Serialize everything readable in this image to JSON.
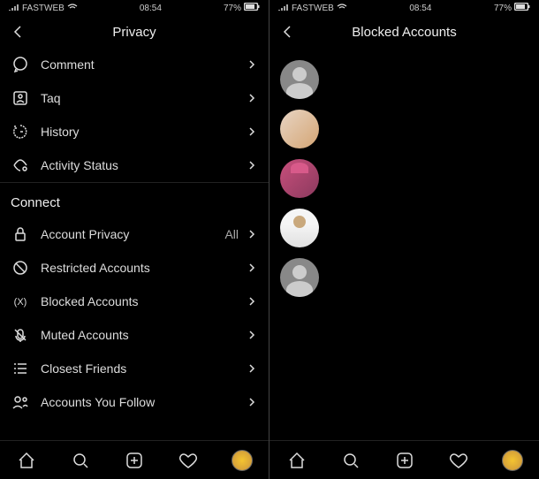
{
  "left": {
    "status": {
      "carrier": "FASTWEB",
      "time": "08:54",
      "battery": "77%"
    },
    "header": {
      "title": "Privacy"
    },
    "menu1": [
      {
        "icon": "comment-icon",
        "label": "Comment"
      },
      {
        "icon": "tag-icon",
        "label": "Taq"
      },
      {
        "icon": "history-icon",
        "label": "History"
      },
      {
        "icon": "activity-icon",
        "label": "Activity Status"
      }
    ],
    "section": "Connect",
    "menu2": [
      {
        "icon": "lock-icon",
        "label": "Account Privacy",
        "value": "All"
      },
      {
        "icon": "restricted-icon",
        "label": "Restricted Accounts"
      },
      {
        "icon": "blocked-icon",
        "label": "Blocked Accounts"
      },
      {
        "icon": "muted-icon",
        "label": "Muted Accounts"
      },
      {
        "icon": "friends-icon",
        "label": "Closest Friends"
      },
      {
        "icon": "follow-icon",
        "label": "Accounts You Follow"
      }
    ]
  },
  "right": {
    "status": {
      "carrier": "FASTWEB",
      "time": "08:54",
      "battery": "77%"
    },
    "header": {
      "title": "Blocked Accounts"
    },
    "blocked": [
      {
        "type": "default"
      },
      {
        "type": "photo1"
      },
      {
        "type": "photo2"
      },
      {
        "type": "photo3"
      },
      {
        "type": "default"
      }
    ]
  }
}
